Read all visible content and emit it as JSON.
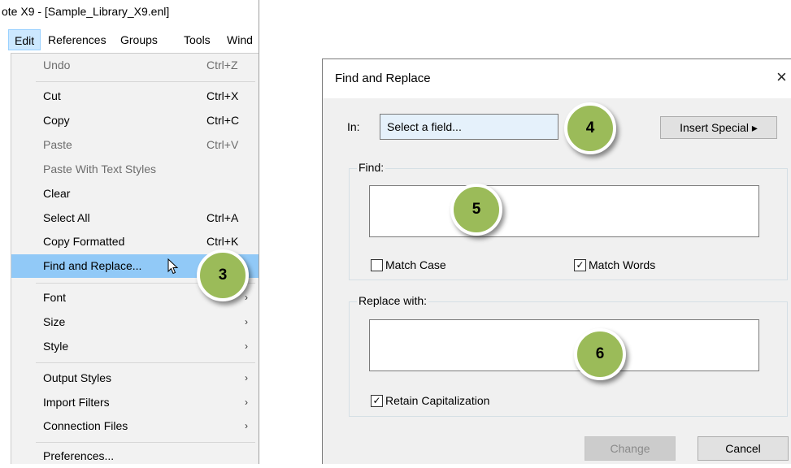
{
  "window": {
    "title": "ote X9 - [Sample_Library_X9.enl]"
  },
  "menu_bar": {
    "items": [
      "Edit",
      "References",
      "Groups",
      "Tools",
      "Wind"
    ]
  },
  "edit_menu": {
    "undo": {
      "label": "Undo",
      "shortcut": "Ctrl+Z"
    },
    "cut": {
      "label": "Cut",
      "shortcut": "Ctrl+X"
    },
    "copy": {
      "label": "Copy",
      "shortcut": "Ctrl+C"
    },
    "paste": {
      "label": "Paste",
      "shortcut": "Ctrl+V"
    },
    "paste_styles": {
      "label": "Paste With Text Styles"
    },
    "clear": {
      "label": "Clear"
    },
    "select_all": {
      "label": "Select All",
      "shortcut": "Ctrl+A"
    },
    "copy_formatted": {
      "label": "Copy Formatted",
      "shortcut": "Ctrl+K"
    },
    "find_replace": {
      "label": "Find and Replace..."
    },
    "font": {
      "label": "Font"
    },
    "size": {
      "label": "Size"
    },
    "style": {
      "label": "Style"
    },
    "output_styles": {
      "label": "Output Styles"
    },
    "import_filters": {
      "label": "Import Filters"
    },
    "connection_files": {
      "label": "Connection Files"
    },
    "preferences": {
      "label": "Preferences..."
    },
    "submenu_arrow": "›"
  },
  "dialog": {
    "title": "Find and Replace",
    "close_glyph": "×",
    "in_label": "In:",
    "field_select": "Select a field...",
    "insert_special": "Insert Special ▸",
    "find_label": "Find:",
    "find_value": "",
    "match_case_label": "Match Case",
    "match_case_checked": false,
    "match_words_label": "Match Words",
    "match_words_checked": true,
    "replace_label": "Replace with:",
    "replace_value": "",
    "retain_cap_label": "Retain Capitalization",
    "retain_cap_checked": true,
    "change_button": "Change",
    "cancel_button": "Cancel",
    "check_glyph": "✓"
  },
  "callouts": {
    "step3": "3",
    "step4": "4",
    "step5": "5",
    "step6": "6"
  },
  "colors": {
    "callout_fill": "#9bbb59",
    "menu_highlight": "#91c9f7",
    "menubar_active": "#cce8ff"
  }
}
